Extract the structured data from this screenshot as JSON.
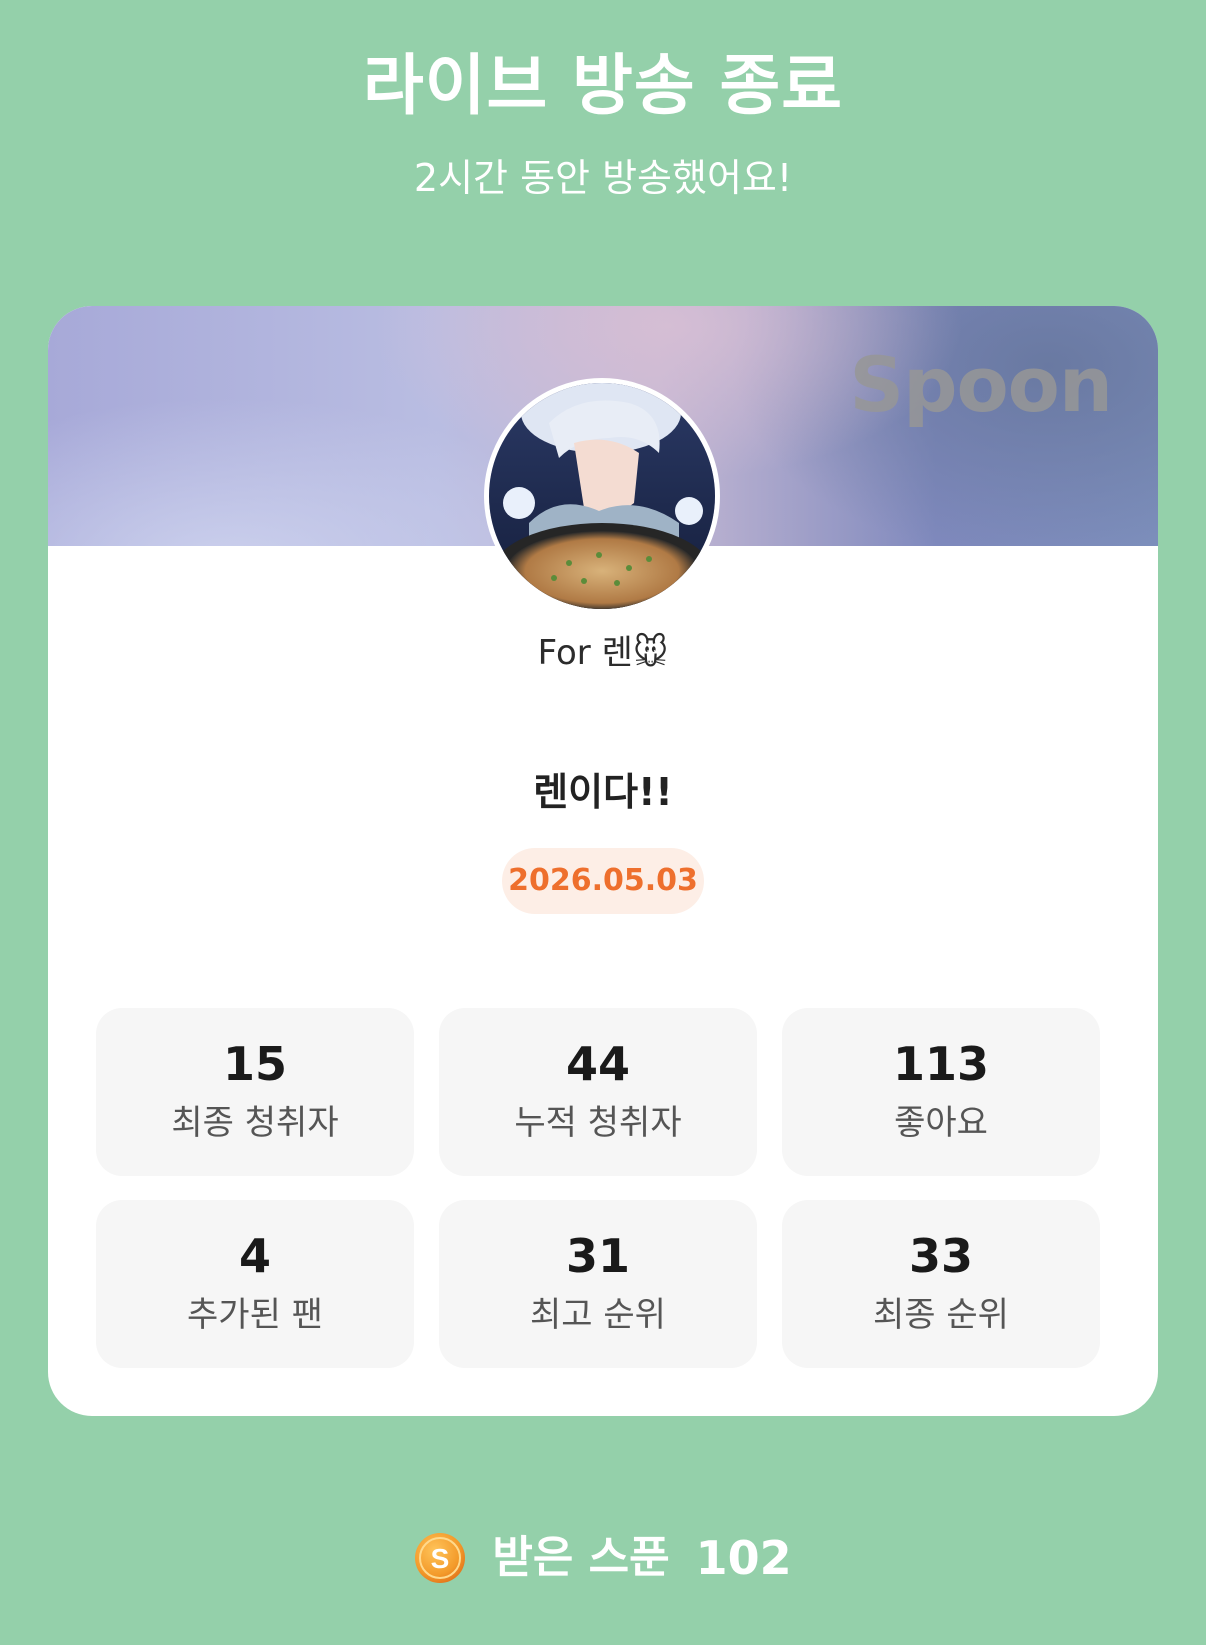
{
  "header": {
    "title": "라이브 방송 종료",
    "subtitle": "2시간 동안 방송했어요!"
  },
  "card": {
    "brand": "Spoon",
    "host_name": "For 렌🐭",
    "live_title": "렌이다!!",
    "date": "2026.05.03"
  },
  "stats": [
    {
      "value": "15",
      "label": "최종 청취자"
    },
    {
      "value": "44",
      "label": "누적 청취자"
    },
    {
      "value": "113",
      "label": "좋아요"
    },
    {
      "value": "4",
      "label": "추가된 팬"
    },
    {
      "value": "31",
      "label": "최고 순위"
    },
    {
      "value": "33",
      "label": "최종 순위"
    }
  ],
  "footer": {
    "coin_icon": "spoon-coin-icon",
    "received_label": "받은 스푼",
    "received_value": "102"
  },
  "colors": {
    "background": "#94d0aa",
    "date_accent": "#ee6f2d",
    "date_badge_bg": "#fdeee6",
    "stat_box": "#f6f6f6"
  }
}
